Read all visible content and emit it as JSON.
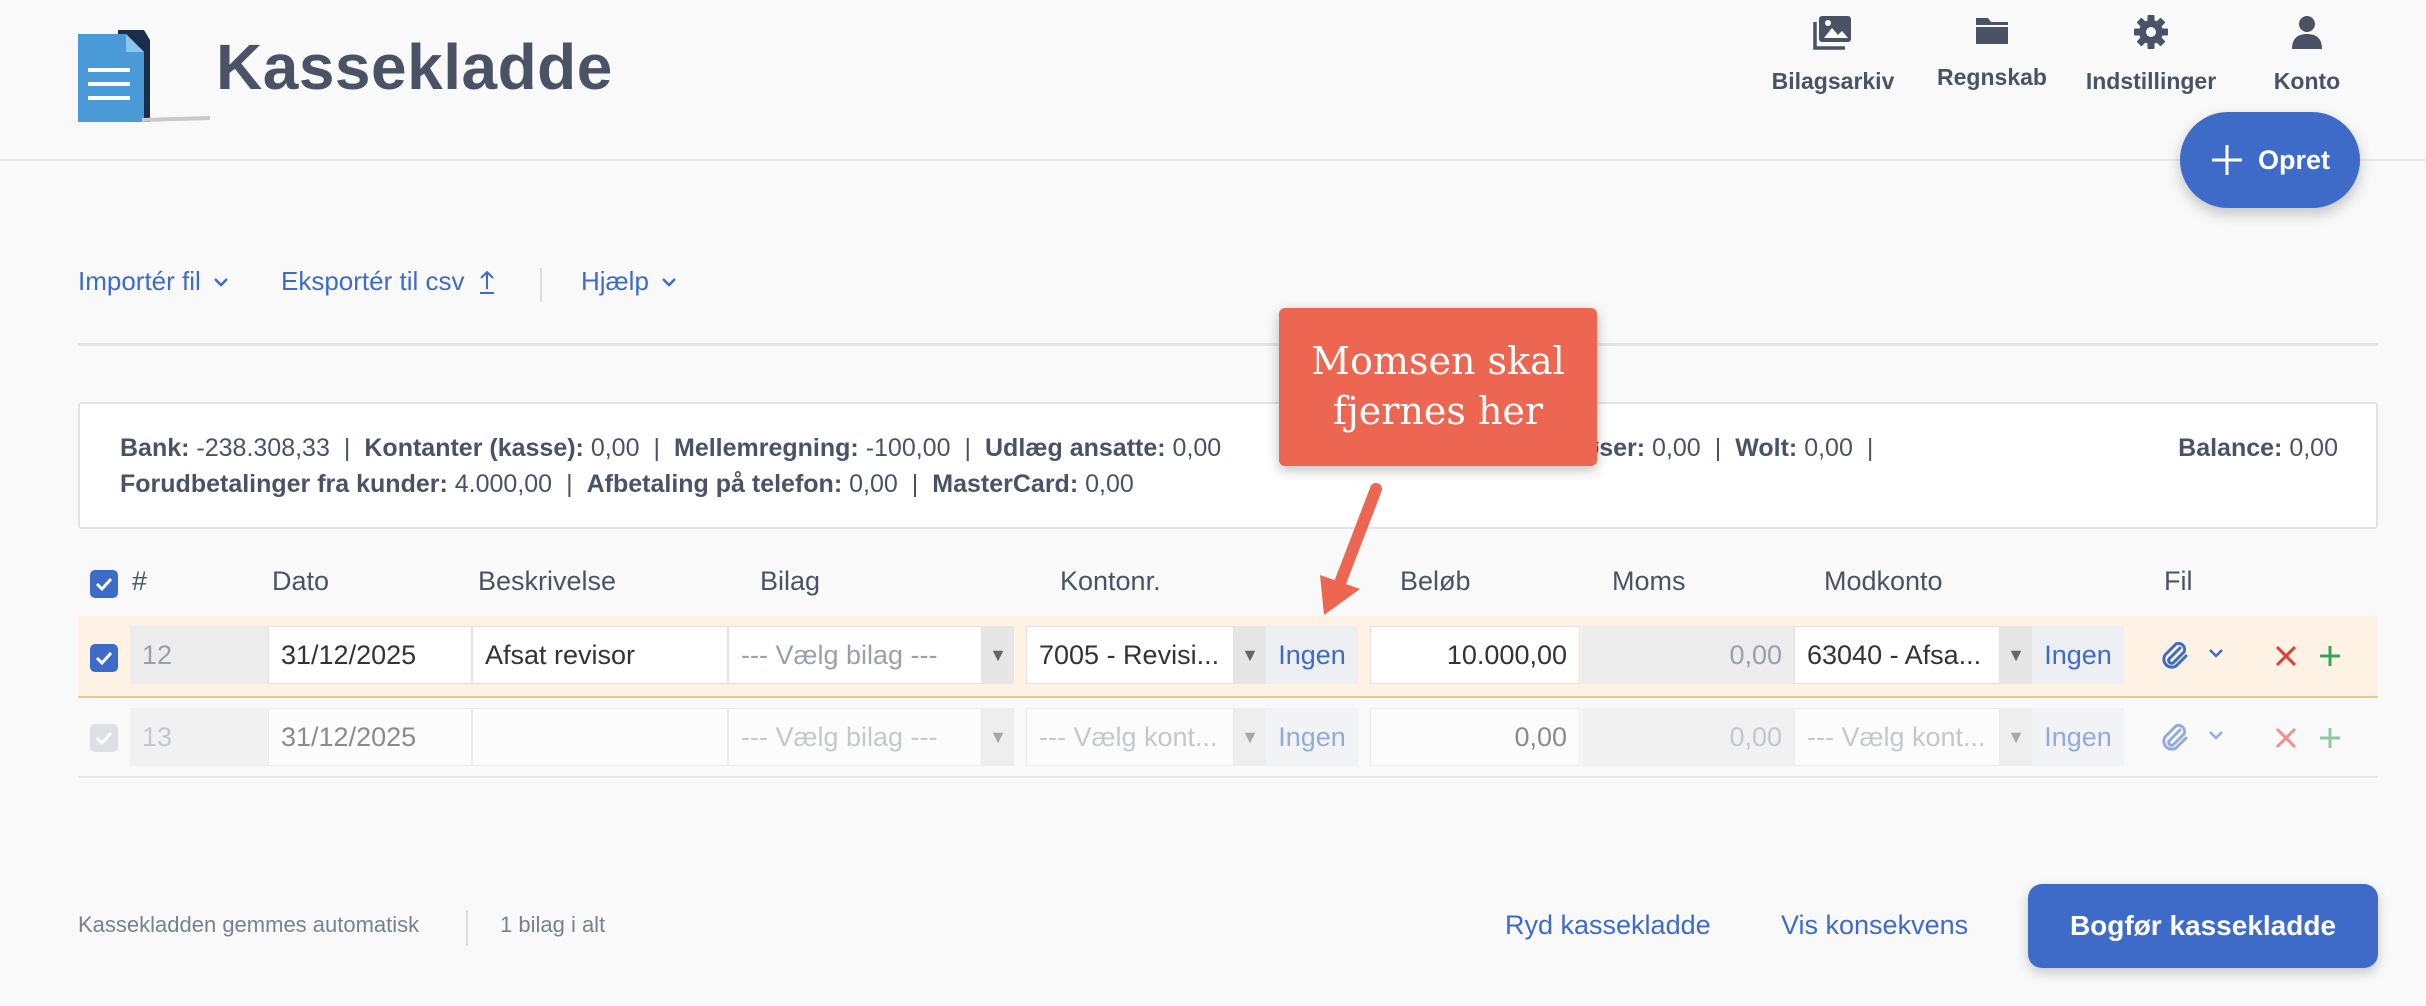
{
  "app": {
    "title": "Kassekladde"
  },
  "nav": [
    {
      "label": "Bilagsarkiv",
      "icon": "photo-library-icon"
    },
    {
      "label": "Regnskab",
      "icon": "folder-icon"
    },
    {
      "label": "Indstillinger",
      "icon": "gear-icon"
    },
    {
      "label": "Konto",
      "icon": "user-icon"
    }
  ],
  "opret": {
    "label": "Opret"
  },
  "toolbar": {
    "import_label": "Importér fil",
    "export_label": "Eksportér til csv",
    "help_label": "Hjælp"
  },
  "summary": {
    "line1": [
      {
        "label": "Bank:",
        "value": "-238.308,33"
      },
      {
        "label": "Kontanter (kasse):",
        "value": "0,00"
      },
      {
        "label": "Mellemregning:",
        "value": "-100,00"
      },
      {
        "label": "Udlæg ansatte:",
        "value": "0,00"
      }
    ],
    "line1_hidden": [
      {
        "label": "løser:",
        "value": "0,00"
      },
      {
        "label": "Wolt:",
        "value": "0,00"
      }
    ],
    "line2": [
      {
        "label": "Forudbetalinger fra kunder:",
        "value": "4.000,00"
      },
      {
        "label": "Afbetaling på telefon:",
        "value": "0,00"
      },
      {
        "label": "MasterCard:",
        "value": "0,00"
      }
    ],
    "balance": {
      "label": "Balance:",
      "value": "0,00"
    }
  },
  "callout": {
    "line1": "Momsen skal",
    "line2": "fjernes her",
    "color": "#ec6652"
  },
  "table": {
    "headers": {
      "num": "#",
      "dato": "Dato",
      "beskrivelse": "Beskrivelse",
      "bilag": "Bilag",
      "kontonr": "Kontonr.",
      "belob": "Beløb",
      "moms": "Moms",
      "modkonto": "Modkonto",
      "fil": "Fil"
    },
    "rows": [
      {
        "num": "12",
        "dato": "31/12/2025",
        "beskrivelse": "Afsat revisor",
        "bilag": "--- Vælg bilag ---",
        "kontonr": "7005 - Revisi...",
        "konto_moms": "Ingen",
        "belob": "10.000,00",
        "moms": "0,00",
        "modkonto": "63040 - Afsa...",
        "modkonto_moms": "Ingen"
      },
      {
        "num": "13",
        "dato": "31/12/2025",
        "beskrivelse": "",
        "bilag": "--- Vælg bilag ---",
        "kontonr": "--- Vælg kont...",
        "konto_moms": "Ingen",
        "belob": "0,00",
        "moms": "0,00",
        "modkonto": "--- Vælg kont...",
        "modkonto_moms": "Ingen"
      }
    ]
  },
  "footer": {
    "autosave": "Kassekladden gemmes automatisk",
    "count": "1 bilag i alt",
    "clear_label": "Ryd kassekladde",
    "consequence_label": "Vis konsekvens",
    "post_label": "Bogfør kassekladde"
  },
  "colors": {
    "accent": "#3f6bc8",
    "callout": "#ec6652",
    "row_highlight": "#fdf2e4"
  }
}
